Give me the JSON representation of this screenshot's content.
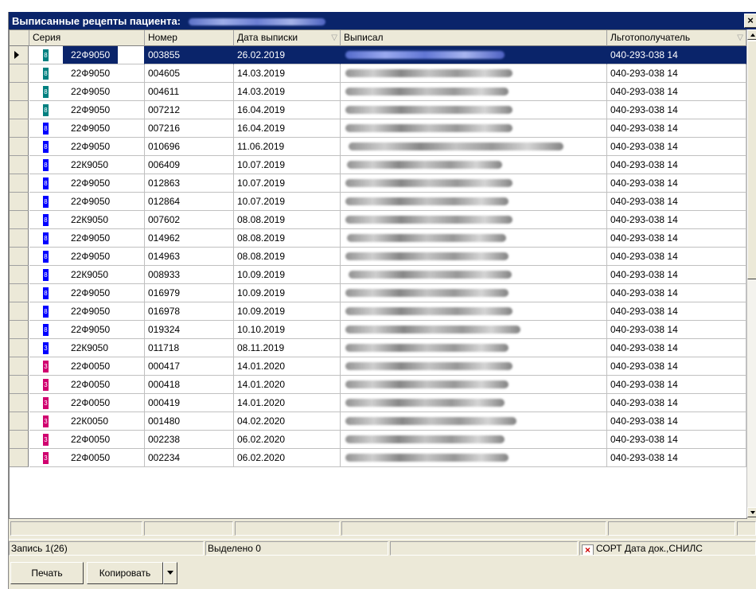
{
  "window": {
    "title": "Выписанные рецепты пациента:",
    "close_glyph": "×"
  },
  "columns": {
    "seria": "Серия",
    "nomer": "Номер",
    "data": "Дата выписки",
    "vypisal": "Выписал",
    "lgot": "Льготополучатель"
  },
  "colors": {
    "teal": "#008080",
    "blue": "#0000ff",
    "magenta": "#d0006f",
    "selection": "#0a246a"
  },
  "rows": [
    {
      "seria": "22Ф9050",
      "nomer": "003855",
      "data": "26.02.2019",
      "lgot": "040-293-038 14",
      "badge": "teal",
      "badge_text": "8"
    },
    {
      "seria": "22Ф9050",
      "nomer": "004605",
      "data": "14.03.2019",
      "lgot": "040-293-038 14",
      "badge": "teal",
      "badge_text": "8"
    },
    {
      "seria": "22Ф9050",
      "nomer": "004611",
      "data": "14.03.2019",
      "lgot": "040-293-038 14",
      "badge": "teal",
      "badge_text": "8"
    },
    {
      "seria": "22Ф9050",
      "nomer": "007212",
      "data": "16.04.2019",
      "lgot": "040-293-038 14",
      "badge": "teal",
      "badge_text": "8"
    },
    {
      "seria": "22Ф9050",
      "nomer": "007216",
      "data": "16.04.2019",
      "lgot": "040-293-038 14",
      "badge": "blue",
      "badge_text": "8"
    },
    {
      "seria": "22Ф9050",
      "nomer": "010696",
      "data": "11.06.2019",
      "lgot": "040-293-038 14",
      "badge": "blue",
      "badge_text": "8"
    },
    {
      "seria": "22К9050",
      "nomer": "006409",
      "data": "10.07.2019",
      "lgot": "040-293-038 14",
      "badge": "blue",
      "badge_text": "8"
    },
    {
      "seria": "22Ф9050",
      "nomer": "012863",
      "data": "10.07.2019",
      "lgot": "040-293-038 14",
      "badge": "blue",
      "badge_text": "8"
    },
    {
      "seria": "22Ф9050",
      "nomer": "012864",
      "data": "10.07.2019",
      "lgot": "040-293-038 14",
      "badge": "blue",
      "badge_text": "8"
    },
    {
      "seria": "22К9050",
      "nomer": "007602",
      "data": "08.08.2019",
      "lgot": "040-293-038 14",
      "badge": "blue",
      "badge_text": "8"
    },
    {
      "seria": "22Ф9050",
      "nomer": "014962",
      "data": "08.08.2019",
      "lgot": "040-293-038 14",
      "badge": "blue",
      "badge_text": "8"
    },
    {
      "seria": "22Ф9050",
      "nomer": "014963",
      "data": "08.08.2019",
      "lgot": "040-293-038 14",
      "badge": "blue",
      "badge_text": "8"
    },
    {
      "seria": "22К9050",
      "nomer": "008933",
      "data": "10.09.2019",
      "lgot": "040-293-038 14",
      "badge": "blue",
      "badge_text": "8"
    },
    {
      "seria": "22Ф9050",
      "nomer": "016979",
      "data": "10.09.2019",
      "lgot": "040-293-038 14",
      "badge": "blue",
      "badge_text": "8"
    },
    {
      "seria": "22Ф9050",
      "nomer": "016978",
      "data": "10.09.2019",
      "lgot": "040-293-038 14",
      "badge": "blue",
      "badge_text": "8"
    },
    {
      "seria": "22Ф9050",
      "nomer": "019324",
      "data": "10.10.2019",
      "lgot": "040-293-038 14",
      "badge": "blue",
      "badge_text": "8"
    },
    {
      "seria": "22К9050",
      "nomer": "011718",
      "data": "08.11.2019",
      "lgot": "040-293-038 14",
      "badge": "blue",
      "badge_text": "3"
    },
    {
      "seria": "22Ф0050",
      "nomer": "000417",
      "data": "14.01.2020",
      "lgot": "040-293-038 14",
      "badge": "magenta",
      "badge_text": "3"
    },
    {
      "seria": "22Ф0050",
      "nomer": "000418",
      "data": "14.01.2020",
      "lgot": "040-293-038 14",
      "badge": "magenta",
      "badge_text": "3"
    },
    {
      "seria": "22Ф0050",
      "nomer": "000419",
      "data": "14.01.2020",
      "lgot": "040-293-038 14",
      "badge": "magenta",
      "badge_text": "3"
    },
    {
      "seria": "22К0050",
      "nomer": "001480",
      "data": "04.02.2020",
      "lgot": "040-293-038 14",
      "badge": "magenta",
      "badge_text": "3"
    },
    {
      "seria": "22Ф0050",
      "nomer": "002238",
      "data": "06.02.2020",
      "lgot": "040-293-038 14",
      "badge": "magenta",
      "badge_text": "3"
    },
    {
      "seria": "22Ф0050",
      "nomer": "002234",
      "data": "06.02.2020",
      "lgot": "040-293-038 14",
      "badge": "magenta",
      "badge_text": "3"
    }
  ],
  "status": {
    "record": "Запись 1(26)",
    "selected": "Выделено 0",
    "sort": "СОРТ Дата док.,СНИЛС"
  },
  "toolbar": {
    "print": "Печать",
    "copy": "Копировать"
  }
}
